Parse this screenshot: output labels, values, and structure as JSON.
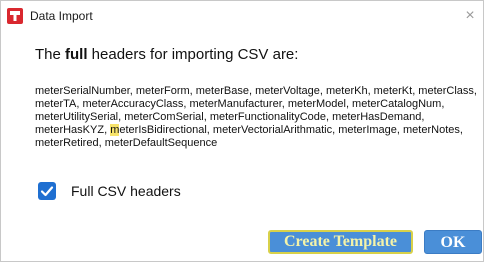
{
  "window": {
    "title": "Data Import",
    "close_glyph": "×"
  },
  "dialog": {
    "heading_prefix": "The ",
    "heading_bold": "full",
    "heading_suffix": " headers for importing CSV are:",
    "headers_before_highlight": "meterSerialNumber, meterForm, meterBase, meterVoltage, meterKh, meterKt, meterClass, meterTA, meterAccuracyClass, meterManufacturer, meterModel, meterCatalogNum, meterUtilitySerial, meterComSerial, meterFunctionalityCode, meterHasDemand, meterHasKYZ, ",
    "headers_highlight": "m",
    "headers_after_highlight": "eterIsBidirectional, meterVectorialArithmatic, meterImage, meterNotes, meterRetired, meterDefaultSequence",
    "checkbox_label": "Full CSV headers",
    "checkbox_checked": true
  },
  "buttons": {
    "create_template": "Create Template",
    "ok": "OK"
  },
  "colors": {
    "accent": "#1f6fd1",
    "button": "#4a8fd8",
    "highlight": "#f7e36a",
    "app_icon": "#d9282f"
  },
  "icons": {
    "app": "app-logo-icon",
    "close": "close-icon",
    "check": "checkmark-icon"
  }
}
